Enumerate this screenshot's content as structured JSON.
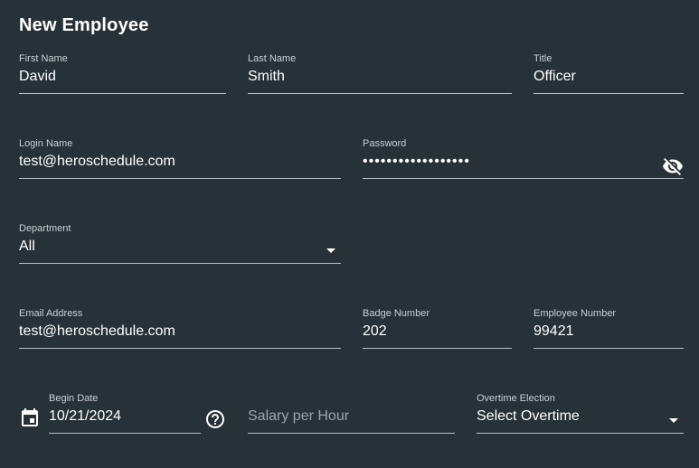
{
  "form": {
    "title": "New Employee"
  },
  "fields": {
    "first_name": {
      "label": "First Name",
      "value": "David"
    },
    "last_name": {
      "label": "Last Name",
      "value": "Smith"
    },
    "title": {
      "label": "Title",
      "value": "Officer"
    },
    "login_name": {
      "label": "Login Name",
      "value": "test@heroschedule.com"
    },
    "password": {
      "label": "Password",
      "masked": "••••••••••••••••••"
    },
    "department": {
      "label": "Department",
      "value": "All"
    },
    "email": {
      "label": "Email Address",
      "value": "test@heroschedule.com"
    },
    "badge_number": {
      "label": "Badge Number",
      "value": "202"
    },
    "employee_number": {
      "label": "Employee Number",
      "value": "99421"
    },
    "begin_date": {
      "label": "Begin Date",
      "value": "10/21/2024"
    },
    "salary": {
      "placeholder": "Salary per Hour"
    },
    "overtime": {
      "label": "Overtime Election",
      "value": "Select Overtime"
    }
  },
  "icons": {
    "password_toggle": "visibility-off-icon",
    "calendar": "calendar-icon",
    "help": "help-icon",
    "dropdown": "chevron-down-icon"
  }
}
